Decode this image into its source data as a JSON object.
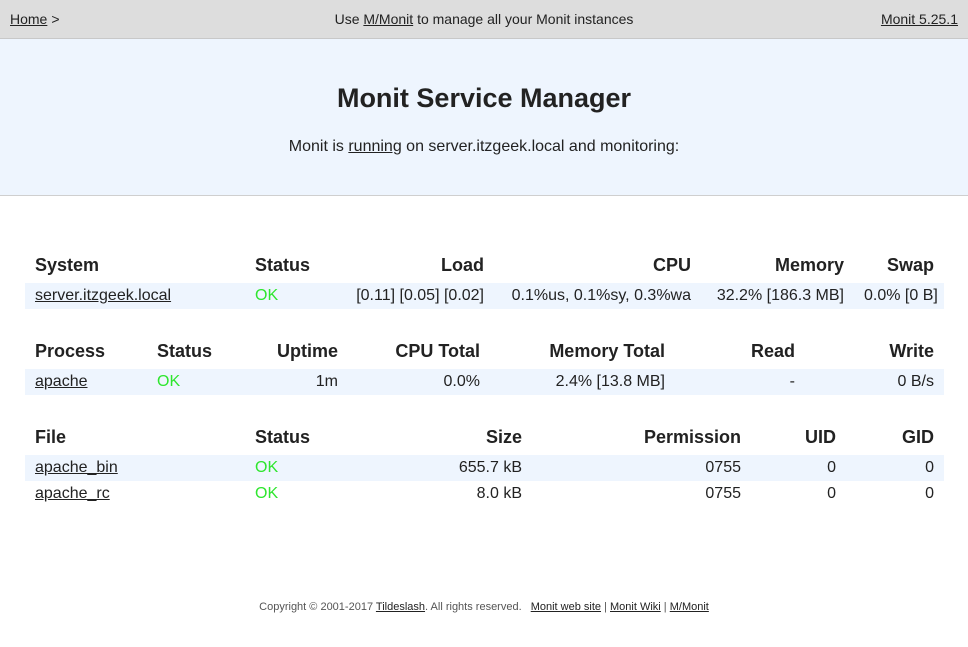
{
  "topbar": {
    "home_link": "Home",
    "home_sep": ">",
    "center_prefix": "Use",
    "center_link": "M/Monit",
    "center_suffix": "to manage all your Monit instances",
    "version_link": "Monit 5.25.1"
  },
  "header": {
    "title": "Monit Service Manager",
    "subtitle_prefix": "Monit is",
    "subtitle_link": "running",
    "subtitle_suffix": "on server.itzgeek.local and monitoring:"
  },
  "system_table": {
    "headers": [
      "System",
      "Status",
      "Load",
      "CPU",
      "Memory",
      "Swap"
    ],
    "rows": [
      {
        "name": "server.itzgeek.local",
        "status": "OK",
        "load": "[0.11] [0.05] [0.02]",
        "cpu": "0.1%us, 0.1%sy, 0.3%wa",
        "memory": "32.2% [186.3 MB]",
        "swap": "0.0% [0 B]"
      }
    ]
  },
  "process_table": {
    "headers": [
      "Process",
      "Status",
      "Uptime",
      "CPU Total",
      "Memory Total",
      "Read",
      "Write"
    ],
    "rows": [
      {
        "name": "apache",
        "status": "OK",
        "uptime": "1m",
        "cpu_total": "0.0%",
        "memory_total": "2.4% [13.8 MB]",
        "read": "-",
        "write": "0 B/s"
      }
    ]
  },
  "file_table": {
    "headers": [
      "File",
      "Status",
      "Size",
      "Permission",
      "UID",
      "GID"
    ],
    "rows": [
      {
        "name": "apache_bin",
        "status": "OK",
        "size": "655.7 kB",
        "permission": "0755",
        "uid": "0",
        "gid": "0"
      },
      {
        "name": "apache_rc",
        "status": "OK",
        "size": "8.0 kB",
        "permission": "0755",
        "uid": "0",
        "gid": "0"
      }
    ]
  },
  "footer": {
    "copyright_prefix": "Copyright © 2001-2017",
    "company_link": "Tildeslash",
    "copyright_suffix": ". All rights reserved.",
    "links": [
      "Monit web site",
      "Monit Wiki",
      "M/Monit"
    ],
    "separator": "|"
  },
  "colors": {
    "topbar_bg": "#dddddd",
    "header_bg": "#eef5fe",
    "row_shade": "#eef5fe",
    "status_ok": "#2ee62e"
  }
}
